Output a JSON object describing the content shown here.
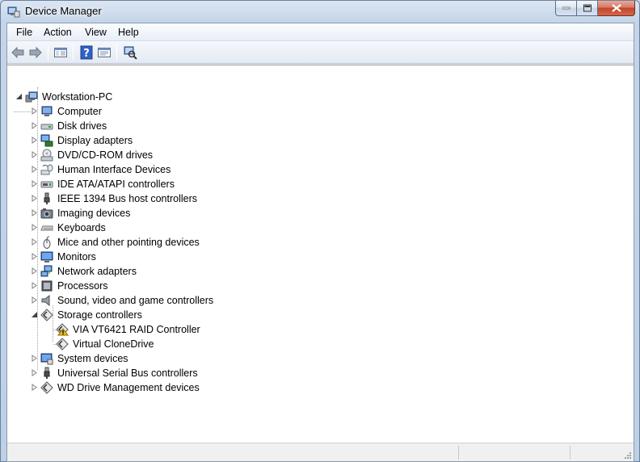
{
  "window": {
    "title": "Device Manager"
  },
  "menu": [
    {
      "id": "file",
      "label": "File"
    },
    {
      "id": "action",
      "label": "Action"
    },
    {
      "id": "view",
      "label": "View"
    },
    {
      "id": "help",
      "label": "Help"
    }
  ],
  "toolbar": [
    "back-arrow-icon",
    "forward-arrow-icon",
    "show-hide-console-tree-icon",
    "help-icon",
    "properties-icon",
    "scan-hardware-icon"
  ],
  "tree": {
    "root": {
      "label": "Workstation-PC",
      "expanded": true,
      "icon": "computer-tower-icon"
    },
    "categories": [
      {
        "label": "Computer",
        "icon": "computer-icon",
        "expanded": false
      },
      {
        "label": "Disk drives",
        "icon": "disk-drive-icon",
        "expanded": false
      },
      {
        "label": "Display adapters",
        "icon": "display-adapter-icon",
        "expanded": false
      },
      {
        "label": "DVD/CD-ROM drives",
        "icon": "dvd-drive-icon",
        "expanded": false
      },
      {
        "label": "Human Interface Devices",
        "icon": "hid-icon",
        "expanded": false
      },
      {
        "label": "IDE ATA/ATAPI controllers",
        "icon": "ide-controller-icon",
        "expanded": false
      },
      {
        "label": "IEEE 1394 Bus host controllers",
        "icon": "firewire-icon",
        "expanded": false
      },
      {
        "label": "Imaging devices",
        "icon": "camera-icon",
        "expanded": false
      },
      {
        "label": "Keyboards",
        "icon": "keyboard-icon",
        "expanded": false
      },
      {
        "label": "Mice and other pointing devices",
        "icon": "mouse-icon",
        "expanded": false
      },
      {
        "label": "Monitors",
        "icon": "monitor-icon",
        "expanded": false
      },
      {
        "label": "Network adapters",
        "icon": "network-adapter-icon",
        "expanded": false
      },
      {
        "label": "Processors",
        "icon": "processor-icon",
        "expanded": false
      },
      {
        "label": "Sound, video and game controllers",
        "icon": "speaker-icon",
        "expanded": false
      },
      {
        "label": "Storage controllers",
        "icon": "storage-controller-icon",
        "expanded": true,
        "children": [
          {
            "label": "VIA VT6421 RAID Controller",
            "icon": "warning-device-icon",
            "warning": true
          },
          {
            "label": "Virtual CloneDrive",
            "icon": "storage-controller-icon",
            "warning": false
          }
        ]
      },
      {
        "label": "System devices",
        "icon": "system-devices-icon",
        "expanded": false
      },
      {
        "label": "Universal Serial Bus controllers",
        "icon": "usb-icon",
        "expanded": false
      },
      {
        "label": "WD Drive Management devices",
        "icon": "storage-controller-icon",
        "expanded": false
      }
    ]
  },
  "colors": {
    "warning": "#f4c20d",
    "accent": "#1c5fbf"
  }
}
